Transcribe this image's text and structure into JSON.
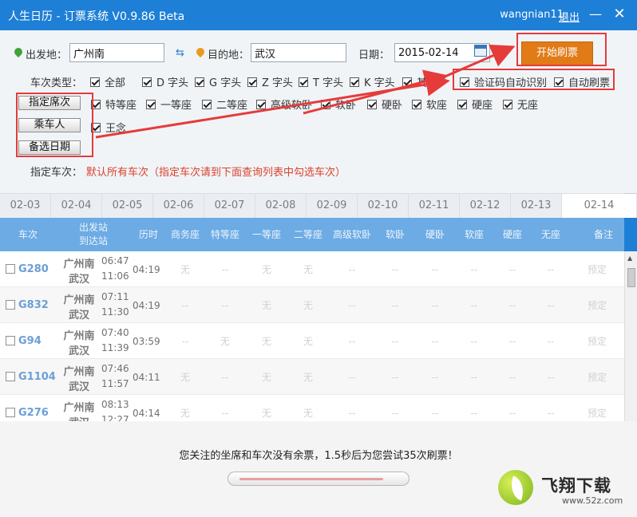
{
  "window": {
    "title": "人生日历 - 订票系统 V0.9.86 Beta",
    "username": "wangnian11",
    "logout_label": "退出",
    "minimize_label": "—",
    "close_label": "✕"
  },
  "search": {
    "from_label": "出发地：",
    "from_value": "广州南",
    "to_label": "目的地：",
    "to_value": "武汉",
    "date_label": "日期：",
    "date_value": "2015-02-14",
    "start_button": "开始刷票",
    "swap_icon": "swap-icon",
    "calendar_icon": "calendar-icon",
    "accent_color": "#e07b18"
  },
  "train_types": {
    "label": "车次类型：",
    "items": [
      {
        "label": "全部",
        "checked": true
      },
      {
        "label": "D 字头",
        "checked": true
      },
      {
        "label": "G 字头",
        "checked": true
      },
      {
        "label": "Z 字头",
        "checked": true
      },
      {
        "label": "T 字头",
        "checked": true
      },
      {
        "label": "K 字头",
        "checked": true
      },
      {
        "label": "其他",
        "checked": true
      }
    ]
  },
  "options": [
    {
      "label": "验证码自动识别",
      "checked": true
    },
    {
      "label": "自动刷票",
      "checked": true
    }
  ],
  "buttons": {
    "seat": "指定席次",
    "passenger": "乘车人",
    "dates": "备选日期"
  },
  "seats": [
    {
      "label": "特等座",
      "checked": true
    },
    {
      "label": "一等座",
      "checked": true
    },
    {
      "label": "二等座",
      "checked": true
    },
    {
      "label": "高级软卧",
      "checked": true
    },
    {
      "label": "软卧",
      "checked": true
    },
    {
      "label": "硬卧",
      "checked": true
    },
    {
      "label": "软座",
      "checked": true
    },
    {
      "label": "硬座",
      "checked": true
    },
    {
      "label": "无座",
      "checked": true
    }
  ],
  "passengers": [
    {
      "label": "王念",
      "checked": true
    }
  ],
  "specified": {
    "label": "指定车次：",
    "note": "默认所有车次（指定车次请到下面查询列表中勾选车次）"
  },
  "date_tabs": [
    "02-03",
    "02-04",
    "02-05",
    "02-06",
    "02-07",
    "02-08",
    "02-09",
    "02-10",
    "02-11",
    "02-12",
    "02-13",
    "02-14"
  ],
  "active_date_tab": "02-14",
  "table": {
    "headers": {
      "train": "车次",
      "depart": "出发站",
      "arrive": "到达站",
      "duration": "历时",
      "business": "商务座",
      "special": "特等座",
      "first": "一等座",
      "second": "二等座",
      "deluxe_sleeper": "高级软卧",
      "soft_sleeper": "软卧",
      "hard_sleeper": "硬卧",
      "soft_seat": "软座",
      "hard_seat": "硬座",
      "no_seat": "无座",
      "note": "备注"
    },
    "rows": [
      {
        "train": "G280",
        "from": "广州南",
        "to": "武汉",
        "dep": "06:47",
        "arr": "11:06",
        "duration": "04:19",
        "seats": [
          "无",
          "--",
          "无",
          "无",
          "--",
          "--",
          "--",
          "--",
          "--",
          "--"
        ],
        "action": "预定"
      },
      {
        "train": "G832",
        "from": "广州南",
        "to": "武汉",
        "dep": "07:11",
        "arr": "11:30",
        "duration": "04:19",
        "seats": [
          "--",
          "--",
          "无",
          "无",
          "--",
          "--",
          "--",
          "--",
          "--",
          "--"
        ],
        "action": "预定"
      },
      {
        "train": "G94",
        "from": "广州南",
        "to": "武汉",
        "dep": "07:40",
        "arr": "11:39",
        "duration": "03:59",
        "seats": [
          "--",
          "无",
          "无",
          "无",
          "--",
          "--",
          "--",
          "--",
          "--",
          "--"
        ],
        "action": "预定"
      },
      {
        "train": "G1104",
        "from": "广州南",
        "to": "武汉",
        "dep": "07:46",
        "arr": "11:57",
        "duration": "04:11",
        "seats": [
          "无",
          "--",
          "无",
          "无",
          "--",
          "--",
          "--",
          "--",
          "--",
          "--"
        ],
        "action": "预定"
      },
      {
        "train": "G276",
        "from": "广州南",
        "to": "武汉",
        "dep": "08:13",
        "arr": "12:27",
        "duration": "04:14",
        "seats": [
          "无",
          "--",
          "无",
          "无",
          "--",
          "--",
          "--",
          "--",
          "--",
          "--"
        ],
        "action": "预定"
      }
    ]
  },
  "status": {
    "message": "您关注的坐席和车次没有余票，1.5秒后为您尝试35次刷票！",
    "progress_percent": 90
  },
  "watermark": {
    "brand": "飞翔下载",
    "url": "www.52z.com",
    "logo_icon": "leaf-logo-icon"
  }
}
